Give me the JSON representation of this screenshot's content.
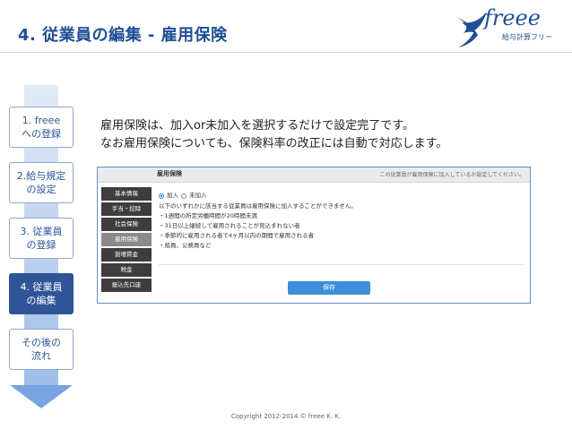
{
  "header": {
    "title": "4. 従業員の編集 - 雇用保険",
    "logo_text": "freee",
    "logo_sub": "給与計算フリー"
  },
  "steps": [
    {
      "label": "1. freee\nへの登録",
      "active": false
    },
    {
      "label": "2.給与規定\nの設定",
      "active": false
    },
    {
      "label": "3. 従業員\nの登録",
      "active": false
    },
    {
      "label": "4. 従業員\nの編集",
      "active": true
    },
    {
      "label": "その後の\n流れ",
      "active": false
    }
  ],
  "description": {
    "line1": "雇用保険は、加入or未加入を選択するだけで設定完了です。",
    "line2": "なお雇用保険についても、保険料率の改正には自動で対応します。"
  },
  "panel": {
    "header_left": "雇用保険",
    "header_right": "この従業員が雇用保険に加入しているか設定してください。",
    "menu": [
      {
        "label": "基本情報",
        "selected": false
      },
      {
        "label": "手当・控除",
        "selected": false
      },
      {
        "label": "社会保険",
        "selected": false
      },
      {
        "label": "雇用保険",
        "selected": true
      },
      {
        "label": "割増賃金",
        "selected": false
      },
      {
        "label": "税金",
        "selected": false
      },
      {
        "label": "振込先口座",
        "selected": false
      }
    ],
    "radio_join": "加入",
    "radio_not_join": "未加入",
    "notice": "以下のいずれかに該当する従業員は雇用保険に加入することができません。",
    "conditions": [
      "・1週間の所定労働時間が20時間未満",
      "・31日以上継続して雇用されることが見込まれない者",
      "・季節的に雇用される者で4ヶ月以内の期間で雇用される者",
      "・船員、公務員など"
    ],
    "save_label": "保存"
  },
  "footer": {
    "copyright": "Copyright 2012-2014 © freee K. K."
  },
  "colors": {
    "title": "#1f4e96",
    "active_step": "#2f5597",
    "save_button": "#3b8fd9"
  }
}
